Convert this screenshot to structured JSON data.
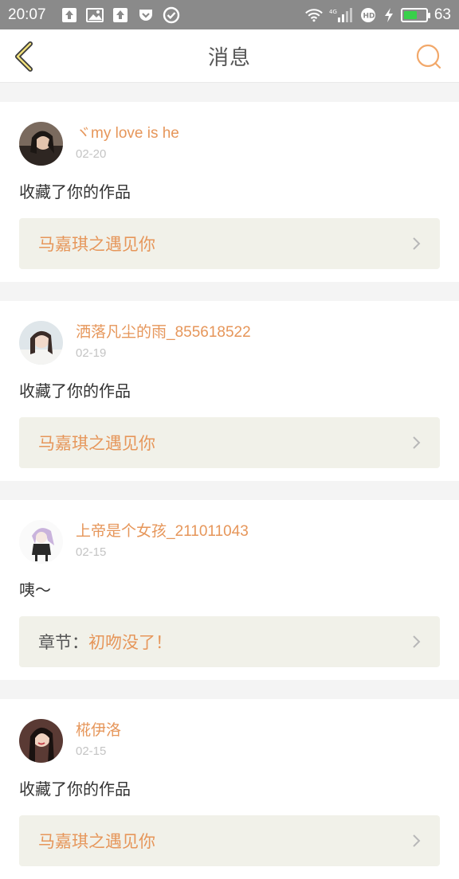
{
  "status_bar": {
    "time": "20:07",
    "battery": "63",
    "battery_level": 0.63
  },
  "nav": {
    "title": "消息"
  },
  "messages": [
    {
      "username": "ヾmy love is he",
      "date": "02-20",
      "text": "收藏了你的作品",
      "link_prefix": "",
      "link_text": "马嘉琪之遇见你"
    },
    {
      "username": "洒落凡尘的雨_855618522",
      "date": "02-19",
      "text": "收藏了你的作品",
      "link_prefix": "",
      "link_text": "马嘉琪之遇见你"
    },
    {
      "username": "上帝是个女孩_211011043",
      "date": "02-15",
      "text": "咦～",
      "link_prefix": "章节：",
      "link_text": "初吻没了！"
    },
    {
      "username": "椛伊洛",
      "date": "02-15",
      "text": "收藏了你的作品",
      "link_prefix": "",
      "link_text": "马嘉琪之遇见你"
    }
  ]
}
